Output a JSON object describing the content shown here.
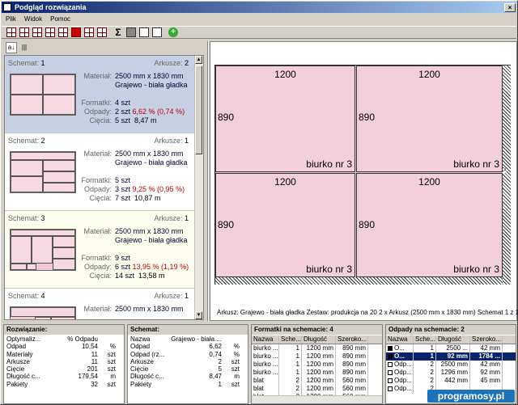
{
  "window": {
    "title": "Podgląd rozwiązania"
  },
  "menu": [
    "Plik",
    "Widok",
    "Pomoc"
  ],
  "toolbar": {
    "sigma": "Σ",
    "plus": "+"
  },
  "left_tabs": {
    "sort": "a↓",
    "bars": "|||"
  },
  "schemes": [
    {
      "title_label": "Schemat:",
      "title_value": "1",
      "ark_label": "Arkusze:",
      "ark_value": "2",
      "material_label": "Materiał:",
      "material_size": "2500 mm x 1830 mm",
      "material_name": "Grajewo - biała gładka",
      "formatki_label": "Formatki:",
      "formatki_value": "4 szt",
      "odpady_label": "Odpady:",
      "odpady_value": "2 szt",
      "odpady_pct": "6,62 % (0,74 %)",
      "ciecia_label": "Cięcia:",
      "ciecia_value": "5 szt",
      "ciecia_len": "8,47 m"
    },
    {
      "title_label": "Schemat:",
      "title_value": "2",
      "ark_label": "Arkusze:",
      "ark_value": "1",
      "material_label": "Materiał:",
      "material_size": "2500 mm x 1830 mm",
      "material_name": "Grajewo - biała gładka",
      "formatki_label": "Formatki:",
      "formatki_value": "5 szt",
      "odpady_label": "Odpady:",
      "odpady_value": "3 szt",
      "odpady_pct": "9,25 % (0,95 %)",
      "ciecia_label": "Cięcia:",
      "ciecia_value": "7 szt",
      "ciecia_len": "10,87 m"
    },
    {
      "title_label": "Schemat:",
      "title_value": "3",
      "ark_label": "Arkusze:",
      "ark_value": "1",
      "material_label": "Materiał:",
      "material_size": "2500 mm x 1830 mm",
      "material_name": "Grajewo - biała gładka",
      "formatki_label": "Formatki:",
      "formatki_value": "9 szt",
      "odpady_label": "Odpady:",
      "odpady_value": "6 szt",
      "odpady_pct": "13,95 % (1,19 %)",
      "ciecia_label": "Cięcia:",
      "ciecia_value": "14 szt",
      "ciecia_len": "13,58 m"
    },
    {
      "title_label": "Schemat:",
      "title_value": "4",
      "ark_label": "Arkusze:",
      "ark_value": "1",
      "material_label": "Materiał:",
      "material_size": "2500 mm x 1830 mm",
      "material_name": "",
      "formatki_label": "",
      "formatki_value": "",
      "odpady_label": "",
      "odpady_value": "",
      "odpady_pct": "",
      "ciecia_label": "",
      "ciecia_value": "",
      "ciecia_len": ""
    }
  ],
  "preview": {
    "panels": [
      {
        "w": "1200",
        "h": "890",
        "name": "biurko nr 3"
      },
      {
        "w": "1200",
        "h": "890",
        "name": "biurko nr 3"
      },
      {
        "w": "1200",
        "h": "890",
        "name": "biurko nr 3"
      },
      {
        "w": "1200",
        "h": "890",
        "name": "biurko nr 3"
      }
    ],
    "side_mark": "X",
    "caption": "Arkusz: Grajewo - biała gładka  Zestaw: produkcja na 20  2 x Arkusz (2500 mm x 1830 mm)  Schemat 1 z 10"
  },
  "solution": {
    "title": "Rozwiązanie:",
    "rows": [
      {
        "k": "Optymaliz...",
        "v": "% Odpadu",
        "u": ""
      },
      {
        "k": "Odpad",
        "v": "10,54",
        "u": "%"
      },
      {
        "k": "Materiały",
        "v": "11",
        "u": "szt"
      },
      {
        "k": "Arkusze",
        "v": "11",
        "u": "szt"
      },
      {
        "k": "Cięcie",
        "v": "201",
        "u": "szt"
      },
      {
        "k": "Długość c...",
        "v": "179,54",
        "u": "m"
      },
      {
        "k": "Pakiety",
        "v": "32",
        "u": "szt"
      }
    ]
  },
  "scheme_panel": {
    "title": "Schemat:",
    "rows": [
      {
        "k": "Nazwa",
        "v": "Grajewo - biała ...",
        "u": ""
      },
      {
        "k": "Odpad",
        "v": "6,62",
        "u": "%"
      },
      {
        "k": "Odpad (rz...",
        "v": "0,74",
        "u": "%"
      },
      {
        "k": "Arkusze",
        "v": "2",
        "u": "szt"
      },
      {
        "k": "Cięcie",
        "v": "5",
        "u": "szt"
      },
      {
        "k": "Długość c...",
        "v": "8,47",
        "u": "m"
      },
      {
        "k": "Pakiety",
        "v": "1",
        "u": "szt"
      }
    ]
  },
  "formatki": {
    "title": "Formatki na schemacie:  4",
    "headers": [
      "Nazwa",
      "Sche...",
      "Długość",
      "Szeroko..."
    ],
    "rows": [
      [
        "biurko ...",
        "1",
        "1200 mm",
        "890 mm"
      ],
      [
        "biurko ...",
        "1",
        "1200 mm",
        "890 mm"
      ],
      [
        "biurko ...",
        "1",
        "1200 mm",
        "890 mm"
      ],
      [
        "biurko ...",
        "1",
        "1200 mm",
        "890 mm"
      ],
      [
        "blat",
        "2",
        "1200 mm",
        "560 mm"
      ],
      [
        "blat",
        "2",
        "1200 mm",
        "560 mm"
      ],
      [
        "blat",
        "2",
        "1200 mm",
        "560 mm"
      ]
    ]
  },
  "odpady": {
    "title": "Odpady na schemacie:  2",
    "headers": [
      "Nazwa",
      "Sche...",
      "Długość",
      "Szeroko..."
    ],
    "rows": [
      {
        "check": true,
        "sel": false,
        "c": [
          "O...",
          "1",
          "2500 ...",
          "42 mm"
        ]
      },
      {
        "check": true,
        "sel": true,
        "c": [
          "O...",
          "1",
          "92 mm",
          "1784 ..."
        ]
      },
      {
        "check": false,
        "sel": false,
        "c": [
          "Odp...",
          "2",
          "2500 mm",
          "42 mm"
        ]
      },
      {
        "check": false,
        "sel": false,
        "c": [
          "Odp...",
          "2",
          "1296 mm",
          "92 mm"
        ]
      },
      {
        "check": false,
        "sel": false,
        "c": [
          "Odp...",
          "2",
          "442 mm",
          "45 mm"
        ]
      },
      {
        "check": false,
        "sel": false,
        "c": [
          "Odp...",
          "2",
          "",
          ""
        ]
      }
    ]
  },
  "watermark": "programosy.pl"
}
